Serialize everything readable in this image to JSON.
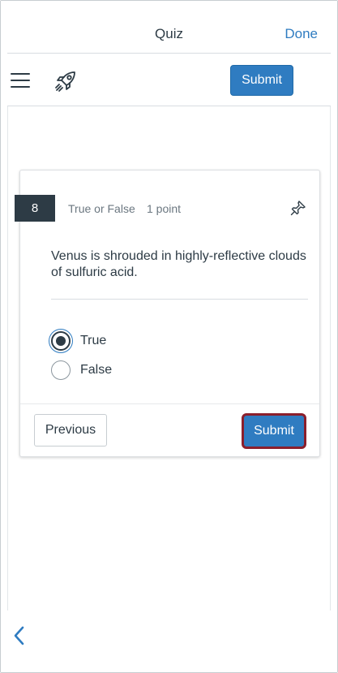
{
  "nav": {
    "title": "Quiz",
    "done_label": "Done"
  },
  "toolbar": {
    "menu_icon": "hamburger-menu-icon",
    "rocket_icon": "rocket-icon",
    "submit_label": "Submit"
  },
  "question": {
    "number": "8",
    "type": "True or False",
    "points": "1 point",
    "pin_icon": "pin-icon",
    "text": "Venus is shrouded in highly-reflective clouds of sulfuric acid.",
    "answers": [
      {
        "label": "True",
        "selected": true
      },
      {
        "label": "False",
        "selected": false
      }
    ],
    "previous_label": "Previous",
    "submit_label": "Submit"
  },
  "bottom": {
    "back_icon": "chevron-left-icon"
  },
  "colors": {
    "accent": "#2f7cc1",
    "text": "#2d3b45",
    "highlight_border": "#8b1f2c"
  }
}
